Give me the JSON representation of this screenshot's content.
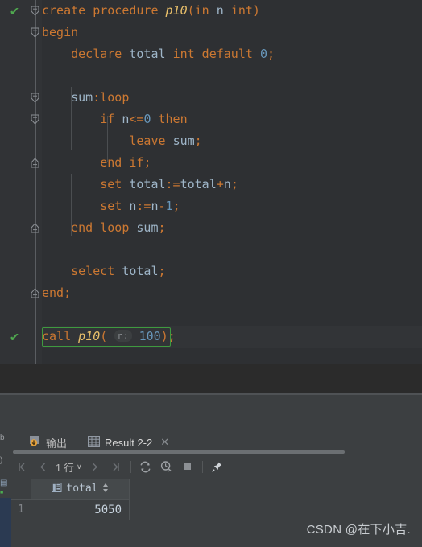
{
  "editor": {
    "lines": [
      {
        "indent": 0,
        "runmark": "✔",
        "fold": "down",
        "tokens": [
          {
            "t": "create procedure ",
            "c": "kw"
          },
          {
            "t": "p10",
            "c": "fn"
          },
          {
            "t": "(",
            "c": "pun"
          },
          {
            "t": "in",
            "c": "kw"
          },
          {
            "t": " ",
            "c": "plain"
          },
          {
            "t": "n",
            "c": "var"
          },
          {
            "t": " ",
            "c": "plain"
          },
          {
            "t": "int",
            "c": "kw"
          },
          {
            "t": ")",
            "c": "pun"
          }
        ]
      },
      {
        "indent": 0,
        "fold": "down",
        "tokens": [
          {
            "t": "begin",
            "c": "kw"
          }
        ]
      },
      {
        "indent": 1,
        "tokens": [
          {
            "t": "declare ",
            "c": "kw"
          },
          {
            "t": "total",
            "c": "var"
          },
          {
            "t": " ",
            "c": "plain"
          },
          {
            "t": "int default",
            "c": "kw"
          },
          {
            "t": " ",
            "c": "plain"
          },
          {
            "t": "0",
            "c": "num"
          },
          {
            "t": ";",
            "c": "pun"
          }
        ]
      },
      {
        "indent": 1,
        "blank": true,
        "tokens": []
      },
      {
        "indent": 1,
        "fold": "down",
        "tokens": [
          {
            "t": "sum",
            "c": "var"
          },
          {
            "t": ":",
            "c": "pun"
          },
          {
            "t": "loop",
            "c": "kw"
          }
        ]
      },
      {
        "indent": 2,
        "fold": "down",
        "tokens": [
          {
            "t": "if",
            "c": "kw"
          },
          {
            "t": " ",
            "c": "plain"
          },
          {
            "t": "n",
            "c": "var"
          },
          {
            "t": "<=",
            "c": "pun"
          },
          {
            "t": "0",
            "c": "num"
          },
          {
            "t": " ",
            "c": "plain"
          },
          {
            "t": "then",
            "c": "kw"
          }
        ]
      },
      {
        "indent": 3,
        "tokens": [
          {
            "t": "leave ",
            "c": "kw"
          },
          {
            "t": "sum",
            "c": "var"
          },
          {
            "t": ";",
            "c": "pun"
          }
        ]
      },
      {
        "indent": 2,
        "fold": "up",
        "tokens": [
          {
            "t": "end if",
            "c": "kw"
          },
          {
            "t": ";",
            "c": "pun"
          }
        ]
      },
      {
        "indent": 2,
        "tokens": [
          {
            "t": "set ",
            "c": "kw"
          },
          {
            "t": "total",
            "c": "var"
          },
          {
            "t": ":=",
            "c": "pun"
          },
          {
            "t": "total",
            "c": "var"
          },
          {
            "t": "+",
            "c": "pun"
          },
          {
            "t": "n",
            "c": "var"
          },
          {
            "t": ";",
            "c": "pun"
          }
        ]
      },
      {
        "indent": 2,
        "tokens": [
          {
            "t": "set ",
            "c": "kw"
          },
          {
            "t": "n",
            "c": "var"
          },
          {
            "t": ":=",
            "c": "pun"
          },
          {
            "t": "n",
            "c": "var"
          },
          {
            "t": "-",
            "c": "pun"
          },
          {
            "t": "1",
            "c": "num"
          },
          {
            "t": ";",
            "c": "pun"
          }
        ]
      },
      {
        "indent": 1,
        "fold": "up",
        "tokens": [
          {
            "t": "end loop ",
            "c": "kw"
          },
          {
            "t": "sum",
            "c": "var"
          },
          {
            "t": ";",
            "c": "pun"
          }
        ]
      },
      {
        "indent": 1,
        "blank": true,
        "tokens": []
      },
      {
        "indent": 1,
        "tokens": [
          {
            "t": "select ",
            "c": "kw"
          },
          {
            "t": "total",
            "c": "var"
          },
          {
            "t": ";",
            "c": "pun"
          }
        ]
      },
      {
        "indent": 0,
        "fold": "up",
        "tokens": [
          {
            "t": "end",
            "c": "kw"
          },
          {
            "t": ";",
            "c": "pun"
          }
        ]
      },
      {
        "indent": 0,
        "blank": true,
        "tokens": []
      },
      {
        "indent": 0,
        "runmark": "✔",
        "callbox": true,
        "band": true,
        "tokens": [
          {
            "t": "call ",
            "c": "kw"
          },
          {
            "t": "p10",
            "c": "fn"
          },
          {
            "t": "(",
            "c": "pun"
          },
          {
            "t": " ",
            "c": "plain"
          },
          {
            "t": "n:",
            "c": "hint"
          },
          {
            "t": " ",
            "c": "plain"
          },
          {
            "t": "100",
            "c": "num"
          },
          {
            "t": ")",
            "c": "pun"
          },
          {
            "t": ";",
            "c": "pun"
          }
        ]
      }
    ]
  },
  "panel": {
    "tabs": [
      {
        "label": "输出",
        "icon": "output-icon",
        "active": false
      },
      {
        "label": "Result 2-2",
        "icon": "table-grid-icon",
        "active": true,
        "closable": true,
        "close_label": "✕"
      }
    ],
    "toolbar": {
      "first_page": "first-page-icon",
      "prev_page": "prev-page-icon",
      "rows_label": "1 行",
      "rows_caret": "∨",
      "next_page": "next-page-icon",
      "last_page": "last-page-icon",
      "refresh": "refresh-icon",
      "query_history": "query-history-icon",
      "stop": "stop-icon",
      "pin": "pin-icon"
    },
    "grid": {
      "columns": [
        {
          "name": "total",
          "icon": "column-icon",
          "sort": "↕"
        }
      ],
      "rows": [
        {
          "num": "1",
          "values": [
            "5050"
          ]
        }
      ]
    }
  },
  "watermark": "CSDN @在下小吉.",
  "colors": {
    "editor_bg": "#2e3033",
    "panel_bg": "#3c3f41",
    "keyword": "#cc7832",
    "function": "#e8bf6a",
    "number": "#6897bb",
    "variable": "#9fb6c9",
    "run_green": "#4fa84f",
    "callbox_green": "#3f9a3f"
  }
}
